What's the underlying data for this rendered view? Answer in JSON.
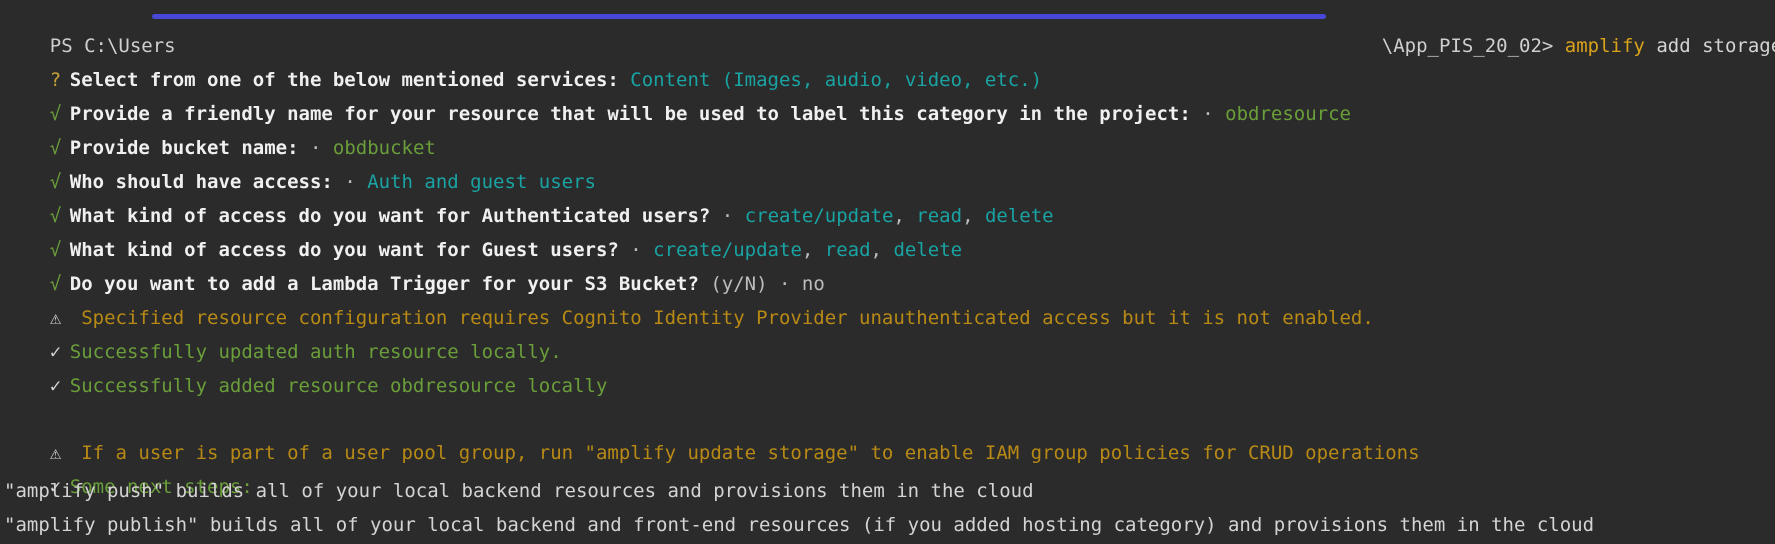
{
  "prompt": {
    "prefix": "PS C:\\Users ",
    "suffix": "\\App_PIS_20_02> ",
    "command_name": "amplify",
    "command_args": " add storage"
  },
  "colors": {
    "redaction_bar": "#4848d8",
    "answer_cyan": "#1aa3a3",
    "answer_green": "#6a9e3a",
    "warning": "#b88a15",
    "command": "#d9a21b"
  },
  "lines": [
    {
      "icon": "?",
      "question": "Select from one of the below mentioned services: ",
      "answer": "Content (Images, audio, video, etc.)"
    },
    {
      "icon": "√",
      "question": "Provide a friendly name for your resource that will be used to label this category in the project: ",
      "sep": "· ",
      "answer": "obdresource"
    },
    {
      "icon": "√",
      "question": "Provide bucket name: ",
      "sep": "· ",
      "answer": "obdbucket"
    },
    {
      "icon": "√",
      "question": "Who should have access: ",
      "sep": "· ",
      "answer": "Auth and guest users"
    },
    {
      "icon": "√",
      "question": "What kind of access do you want for Authenticated users? ",
      "sep": "· ",
      "answer_parts": [
        "create/update",
        ", ",
        "read",
        ", ",
        "delete"
      ]
    },
    {
      "icon": "√",
      "question": "What kind of access do you want for Guest users? ",
      "sep": "· ",
      "answer_parts": [
        "create/update",
        ", ",
        "read",
        ", ",
        "delete"
      ]
    },
    {
      "icon": "√",
      "question": "Do you want to add a Lambda Trigger for your S3 Bucket? ",
      "hint": "(y/N) ",
      "sep": "· ",
      "answer": "no"
    }
  ],
  "messages": {
    "warning_icon": "⚠",
    "check_icon": "✅",
    "warning_1": " Specified resource configuration requires Cognito Identity Provider unauthenticated access but it is not enabled.",
    "success_1": "Successfully updated auth resource locally.",
    "success_2": "Successfully added resource obdresource locally",
    "warning_2": " If a user is part of a user pool group, run \"amplify update storage\" to enable IAM group policies for CRUD operations",
    "next_steps": "Some next steps:",
    "step_push": "\"amplify push\" builds all of your local backend resources and provisions them in the cloud",
    "step_publish": "\"amplify publish\" builds all of your local backend and front-end resources (if you added hosting category) and provisions them in the cloud"
  }
}
